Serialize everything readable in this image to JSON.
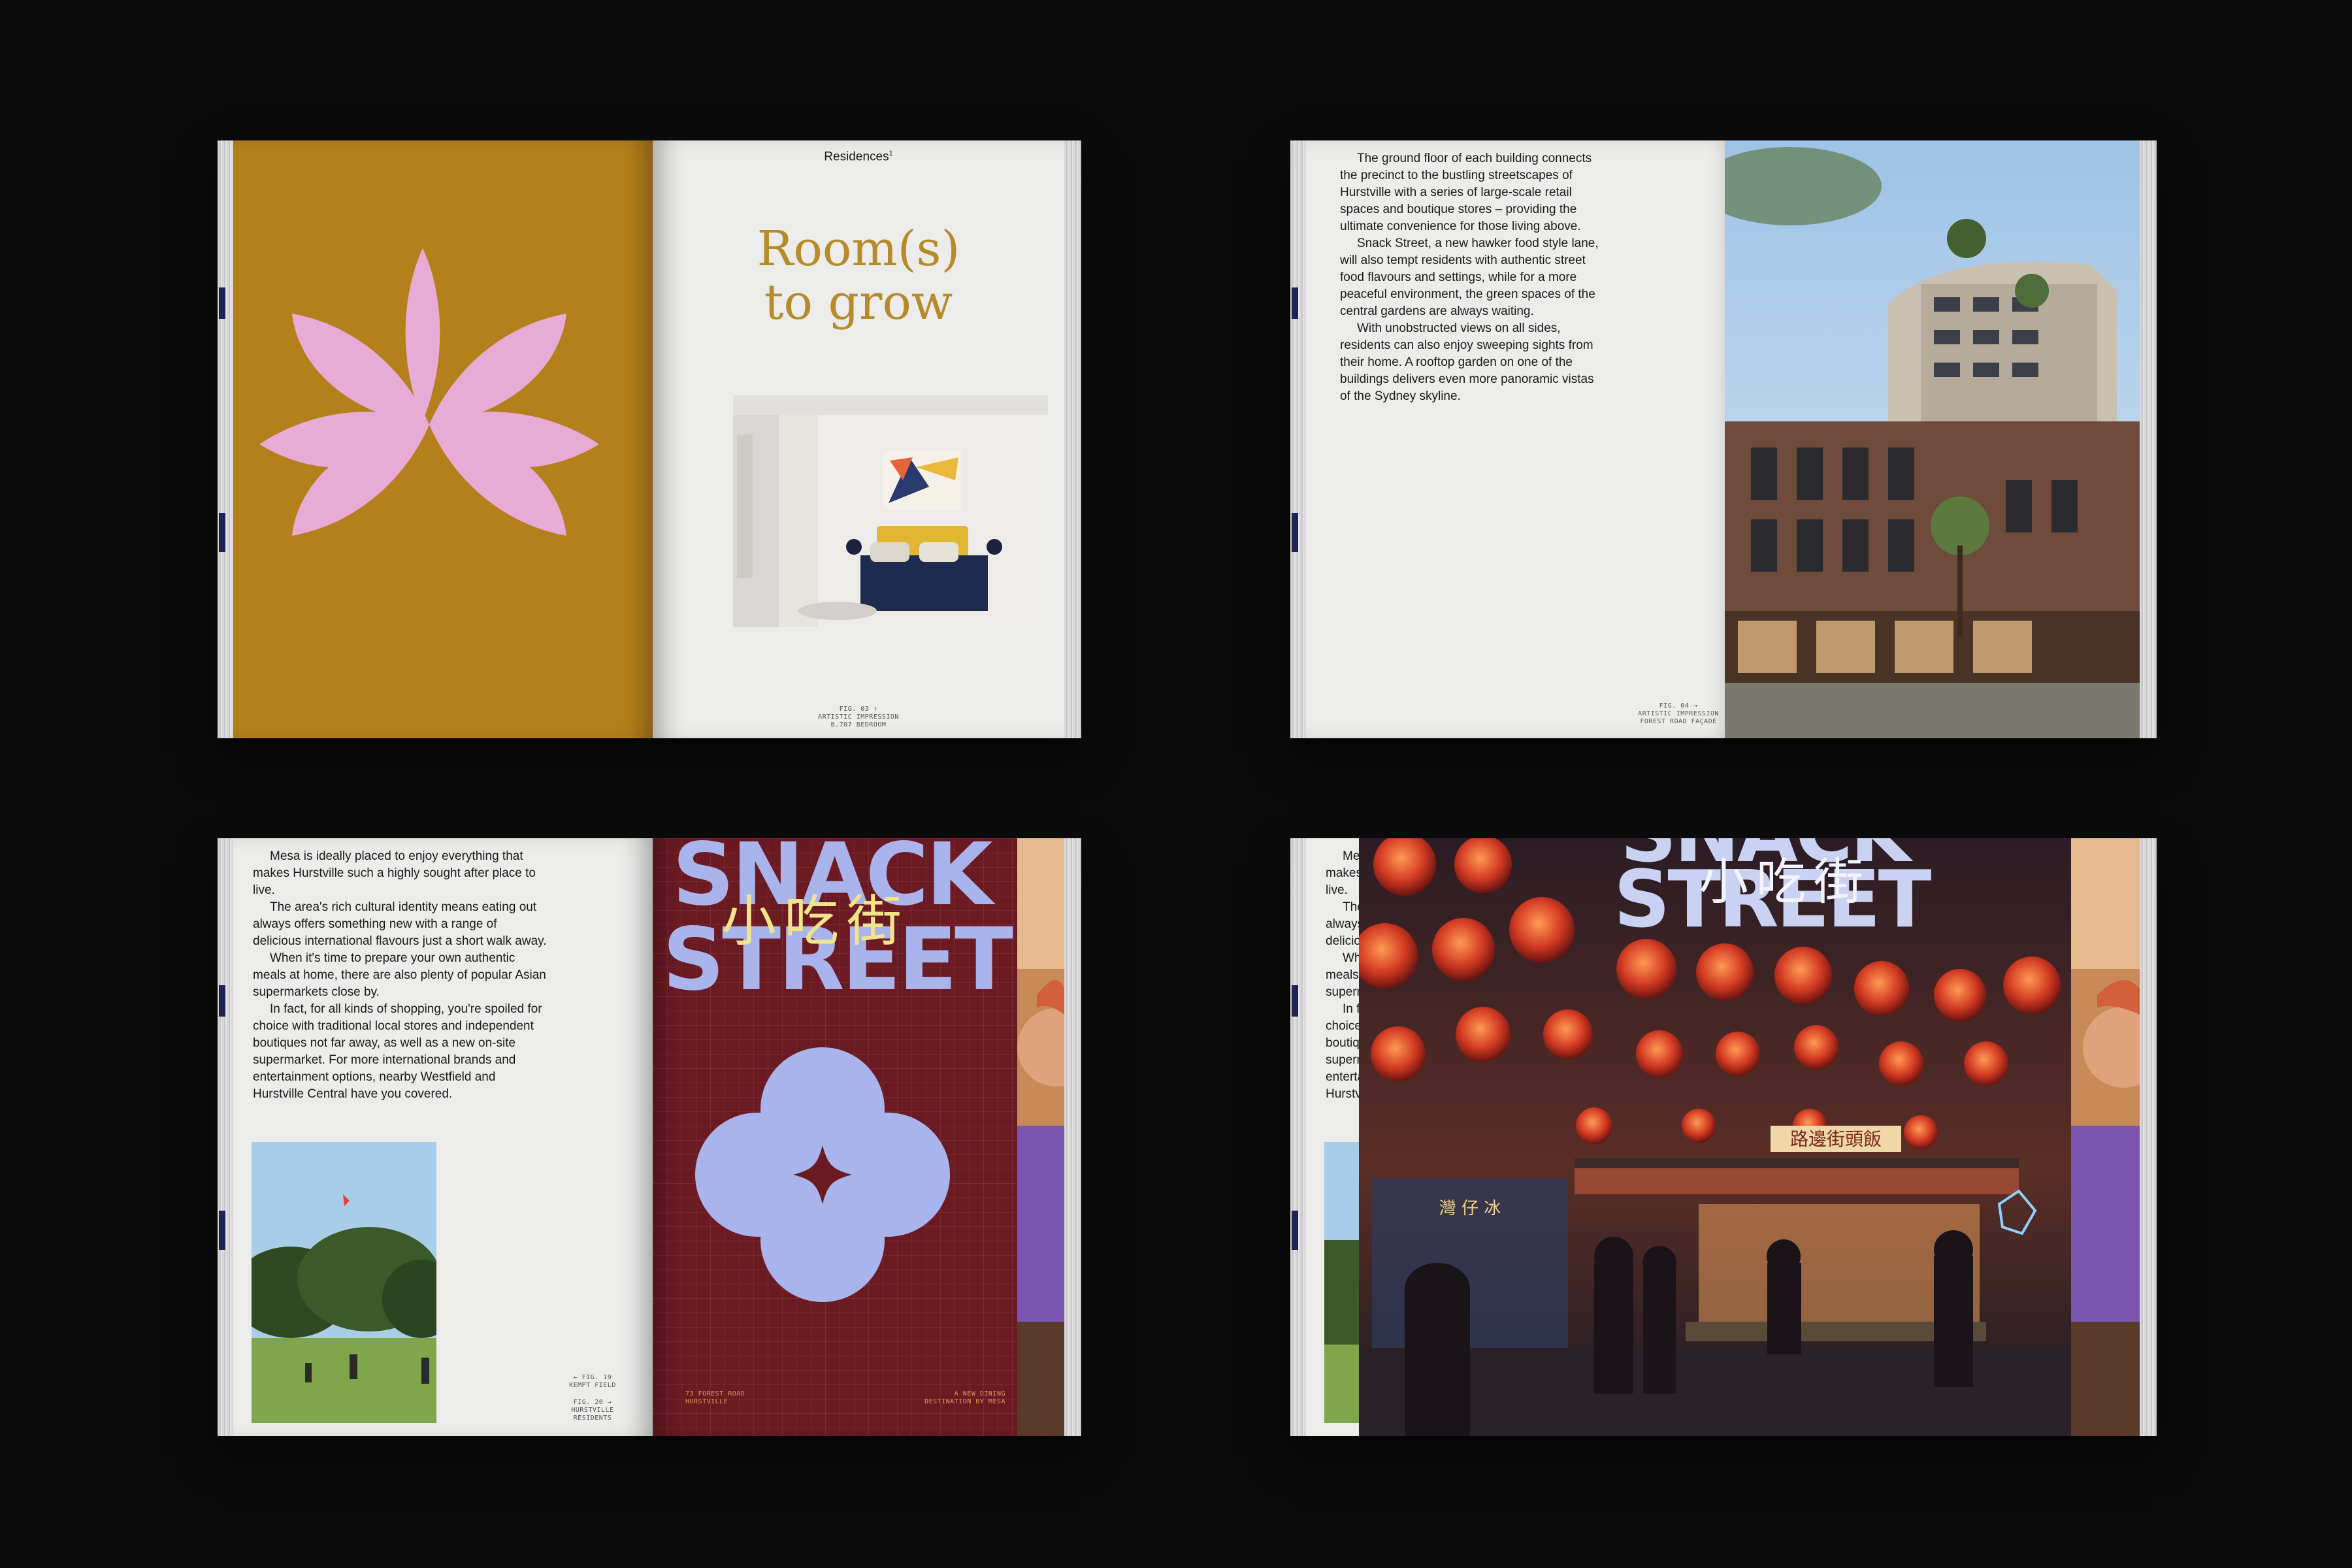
{
  "colors": {
    "background": "#0b0b0b",
    "mustard": "#b4801c",
    "petal_pink": "#e8abd6",
    "maroon": "#6c1a22",
    "lavender": "#a9b4ec",
    "serif_gold": "#b78a2a"
  },
  "spread1": {
    "running_head": "Residences",
    "running_head_sup": "1",
    "headline_line1": "Room(s)",
    "headline_line2": "to grow",
    "caption": "FIG. 03 ↑\nARTISTIC IMPRESSION\nB.707 BEDROOM",
    "photo_label": "bedroom-photo"
  },
  "spread2": {
    "paragraphs": [
      "The ground floor of each building connects the precinct to the bustling streetscapes of Hurstville with a series of large-scale retail spaces and boutique stores – providing the ultimate convenience for those living above.",
      "Snack Street, a new hawker food style lane, will also tempt residents with authentic street food flavours and settings, while for a more peaceful environment, the green spaces of the central gardens are always waiting.",
      "With unobstructed views on all sides, residents can also enjoy sweeping sights from their home. A rooftop garden on one of the buildings delivers even more panoramic vistas of the Sydney skyline."
    ],
    "caption": "FIG. 04 →\nARTISTIC IMPRESSION\nFOREST ROAD FAÇADE"
  },
  "spread3": {
    "paragraphs": [
      "Mesa is ideally placed to enjoy everything that makes Hurstville such a highly sought after place to live.",
      "The area's rich cultural identity means eating out always offers something new with a range of delicious international flavours just a short walk away.",
      "When it's time to prepare your own authentic meals at home, there are also plenty of popular Asian supermarkets close by.",
      "In fact, for all kinds of shopping, you're spoiled for choice with traditional local stores and independent boutiques not far away, as well as a new on-site supermarket. For more international brands and entertainment options, nearby Westfield and Hurstville Central have you covered."
    ],
    "caption_a": "← FIG. 19\nKEMPT FIELD",
    "caption_b": "FIG. 20 →\nHURSTVILLE\nRESIDENTS",
    "snack": "SNACK",
    "street": "STREET",
    "cjk": "小吃街",
    "footer_left": "73 FOREST ROAD\nHURSTVILLE",
    "footer_right": "A NEW DINING\nDESTINATION BY MESA"
  },
  "spread4": {
    "snack": "SNACK",
    "street": "STREET",
    "cjk": "小吃街",
    "stall_sign": "路邊街頭飯",
    "shop_sign": "灣 仔 冰"
  }
}
